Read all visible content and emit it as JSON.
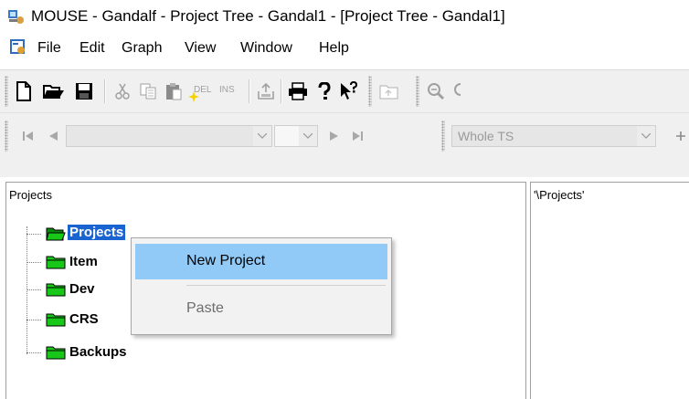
{
  "window": {
    "title": "MOUSE - Gandalf - Project Tree - Gandal1 - [Project Tree - Gandal1]"
  },
  "menubar": {
    "items": [
      "File",
      "Edit",
      "Graph",
      "View",
      "Window",
      "Help"
    ]
  },
  "toolbar1": {
    "del_label": "DEL",
    "ins_label": "INS"
  },
  "toolbar2": {
    "range_value": "Whole TS"
  },
  "left_pane": {
    "header": "Projects",
    "tree": {
      "root_label": "Projects",
      "children": [
        "Item",
        "Dev",
        "CRS",
        "Backups"
      ]
    }
  },
  "right_pane": {
    "path": "'\\Projects'"
  },
  "context_menu": {
    "items": [
      {
        "label": "New Project",
        "state": "highlighted"
      },
      {
        "label": "Paste",
        "state": "disabled"
      }
    ]
  }
}
